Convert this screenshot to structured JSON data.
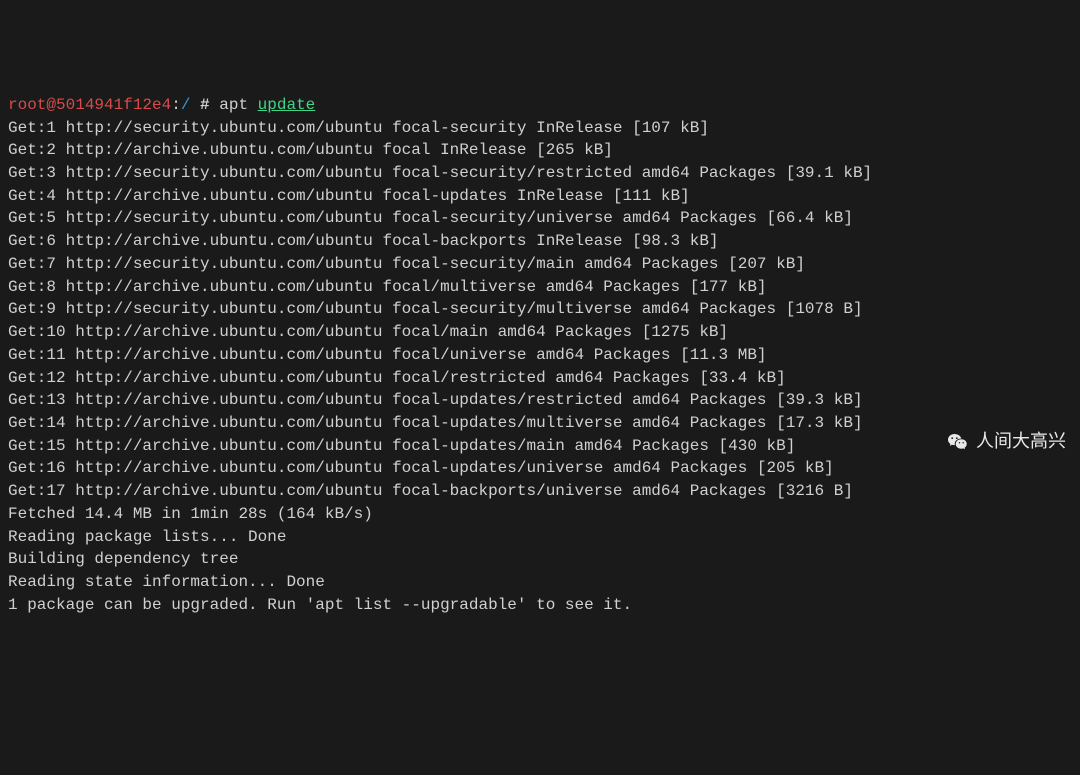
{
  "prompt": {
    "user": "root@5014941f12e4",
    "pathsep": ":",
    "path": "/",
    "hash": " # ",
    "cmd": "apt ",
    "cmd_arg": "update"
  },
  "lines": [
    "Get:1 http://security.ubuntu.com/ubuntu focal-security InRelease [107 kB]",
    "Get:2 http://archive.ubuntu.com/ubuntu focal InRelease [265 kB]",
    "Get:3 http://security.ubuntu.com/ubuntu focal-security/restricted amd64 Packages [39.1 kB]",
    "Get:4 http://archive.ubuntu.com/ubuntu focal-updates InRelease [111 kB]",
    "Get:5 http://security.ubuntu.com/ubuntu focal-security/universe amd64 Packages [66.4 kB]",
    "Get:6 http://archive.ubuntu.com/ubuntu focal-backports InRelease [98.3 kB]",
    "Get:7 http://security.ubuntu.com/ubuntu focal-security/main amd64 Packages [207 kB]",
    "Get:8 http://archive.ubuntu.com/ubuntu focal/multiverse amd64 Packages [177 kB]",
    "Get:9 http://security.ubuntu.com/ubuntu focal-security/multiverse amd64 Packages [1078 B]",
    "Get:10 http://archive.ubuntu.com/ubuntu focal/main amd64 Packages [1275 kB]",
    "Get:11 http://archive.ubuntu.com/ubuntu focal/universe amd64 Packages [11.3 MB]",
    "Get:12 http://archive.ubuntu.com/ubuntu focal/restricted amd64 Packages [33.4 kB]",
    "Get:13 http://archive.ubuntu.com/ubuntu focal-updates/restricted amd64 Packages [39.3 kB]",
    "Get:14 http://archive.ubuntu.com/ubuntu focal-updates/multiverse amd64 Packages [17.3 kB]",
    "Get:15 http://archive.ubuntu.com/ubuntu focal-updates/main amd64 Packages [430 kB]",
    "Get:16 http://archive.ubuntu.com/ubuntu focal-updates/universe amd64 Packages [205 kB]",
    "Get:17 http://archive.ubuntu.com/ubuntu focal-backports/universe amd64 Packages [3216 B]",
    "Fetched 14.4 MB in 1min 28s (164 kB/s)",
    "Reading package lists... Done",
    "Building dependency tree",
    "Reading state information... Done",
    "1 package can be upgraded. Run 'apt list --upgradable' to see it."
  ],
  "watermark": "人间大高兴"
}
